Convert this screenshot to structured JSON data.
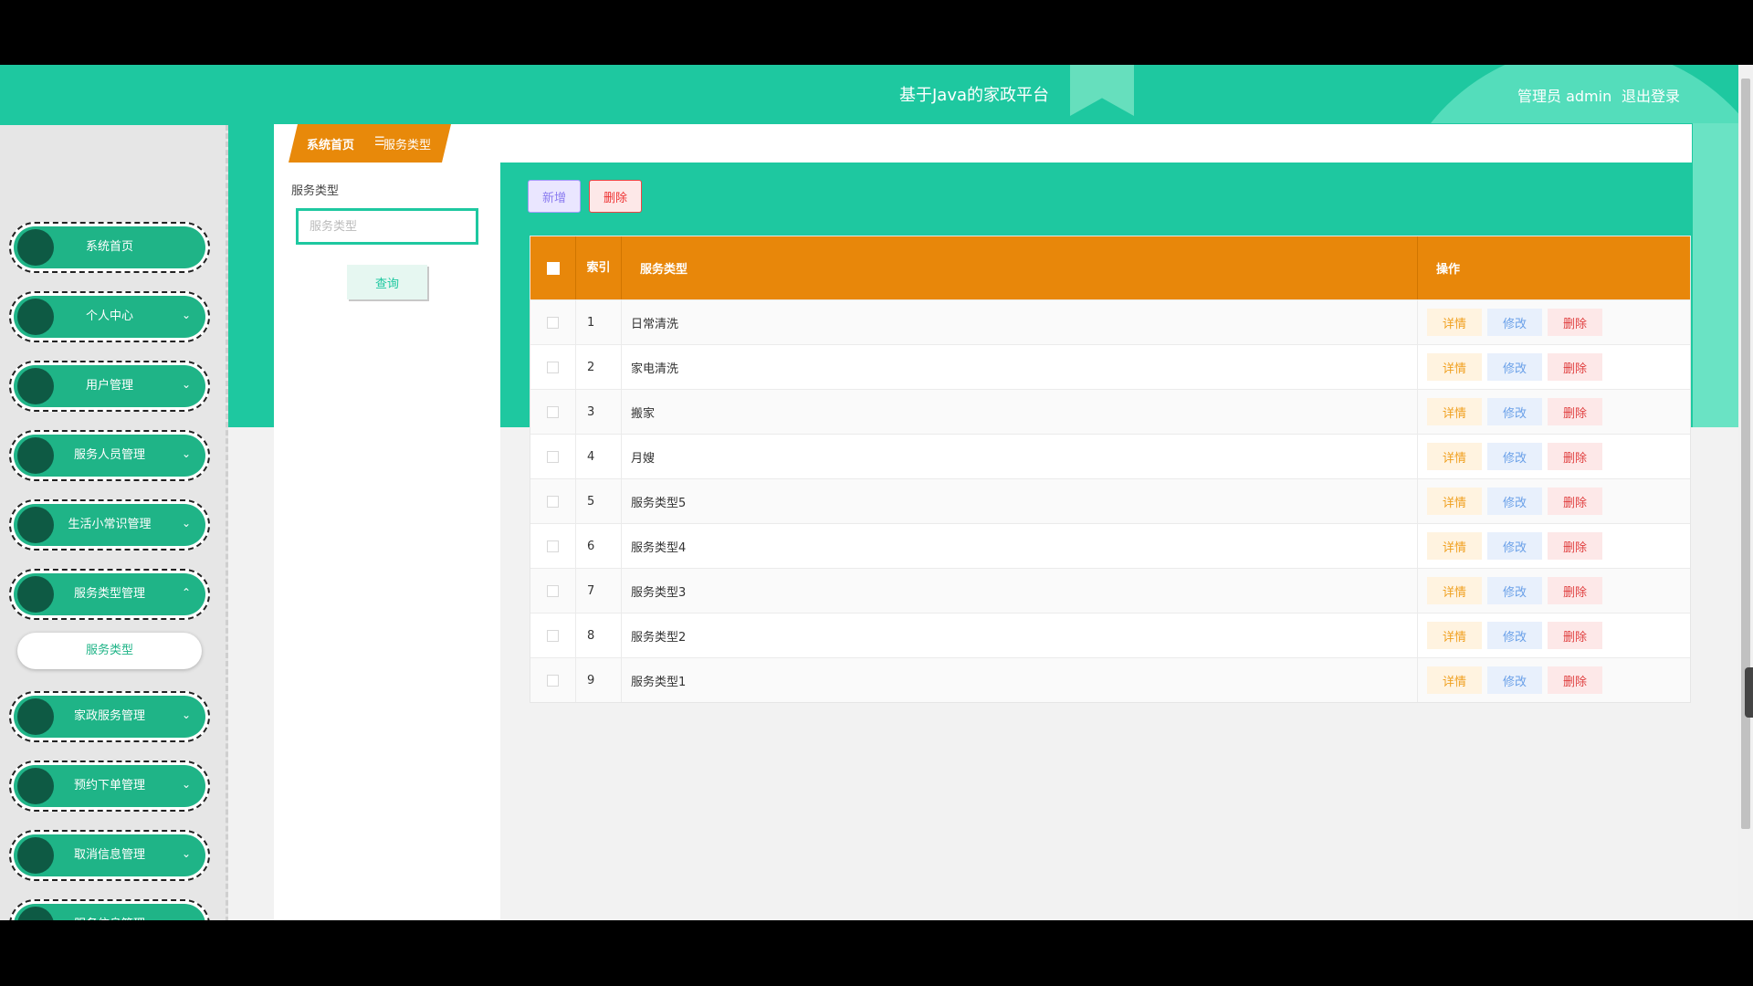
{
  "header": {
    "title": "基于Java的家政平台",
    "user": "管理员 admin",
    "logout": "退出登录"
  },
  "breadcrumb": {
    "home": "系统首页",
    "separator": "☰",
    "current": "服务类型"
  },
  "sidebar": {
    "items": [
      {
        "label": "系统首页",
        "chevron": ""
      },
      {
        "label": "个人中心",
        "chevron": "⌄"
      },
      {
        "label": "用户管理",
        "chevron": "⌄"
      },
      {
        "label": "服务人员管理",
        "chevron": "⌄"
      },
      {
        "label": "生活小常识管理",
        "chevron": "⌄"
      },
      {
        "label": "服务类型管理",
        "chevron": "⌃"
      },
      {
        "label": "家政服务管理",
        "chevron": "⌄"
      },
      {
        "label": "预约下单管理",
        "chevron": "⌄"
      },
      {
        "label": "取消信息管理",
        "chevron": "⌄"
      },
      {
        "label": "服务信息管理",
        "chevron": "⌄"
      }
    ],
    "sub_item": "服务类型"
  },
  "search": {
    "label": "服务类型",
    "placeholder": "服务类型",
    "query_button": "查询"
  },
  "toolbar": {
    "add": "新增",
    "delete": "删除"
  },
  "table": {
    "headers": {
      "index": "索引",
      "name": "服务类型",
      "op": "操作"
    },
    "rows": [
      {
        "index": "1",
        "name": "日常清洗"
      },
      {
        "index": "2",
        "name": "家电清洗"
      },
      {
        "index": "3",
        "name": "搬家"
      },
      {
        "index": "4",
        "name": "月嫂"
      },
      {
        "index": "5",
        "name": "服务类型5"
      },
      {
        "index": "6",
        "name": "服务类型4"
      },
      {
        "index": "7",
        "name": "服务类型3"
      },
      {
        "index": "8",
        "name": "服务类型2"
      },
      {
        "index": "9",
        "name": "服务类型1"
      }
    ],
    "ops": {
      "detail": "详情",
      "edit": "修改",
      "delete": "删除"
    }
  },
  "colors": {
    "teal": "#1ec8a0",
    "orange": "#e8870a",
    "menu_green": "#1fb487"
  }
}
